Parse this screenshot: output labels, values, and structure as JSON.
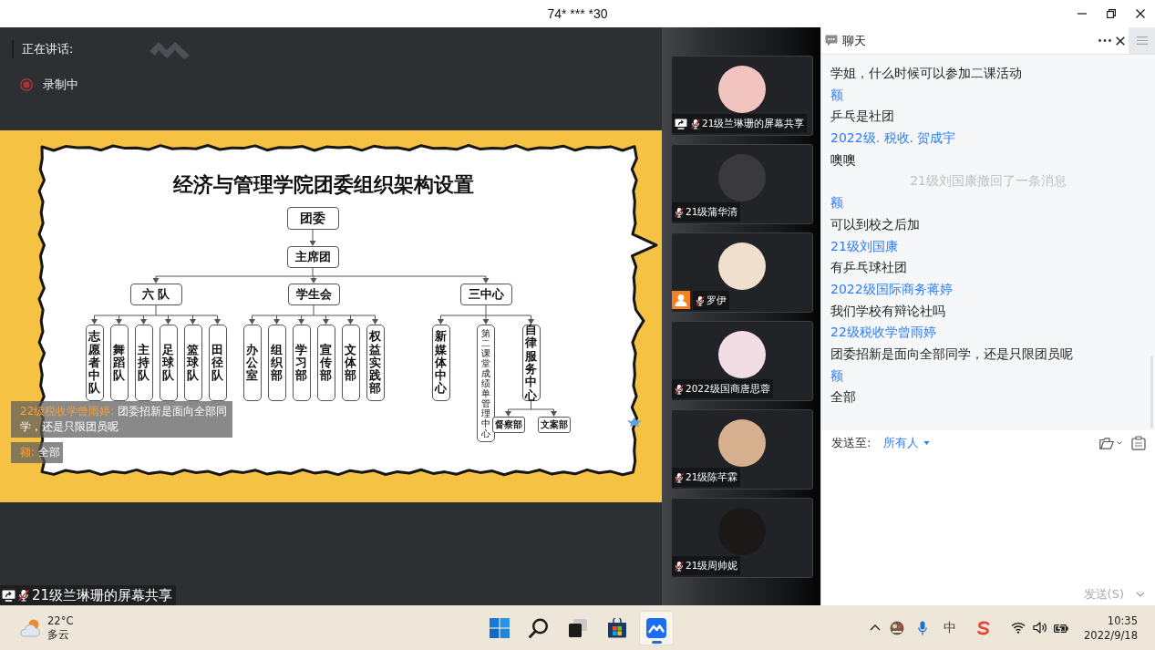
{
  "window": {
    "title": "74* *** *30"
  },
  "stage": {
    "speaking_label": "正在讲话:",
    "recording_label": "录制中"
  },
  "slide": {
    "title": "经济与管理学院团委组织架构设置",
    "org_chart": [
      {
        "label": "团委",
        "children": [
          {
            "label": "主席团",
            "children": [
              {
                "label": "六 队",
                "children": [
                  {
                    "label": "志愿者中队"
                  },
                  {
                    "label": "舞蹈队"
                  },
                  {
                    "label": "主持队"
                  },
                  {
                    "label": "足球队"
                  },
                  {
                    "label": "篮球队"
                  },
                  {
                    "label": "田径队"
                  }
                ]
              },
              {
                "label": "学生会",
                "children": [
                  {
                    "label": "办公室"
                  },
                  {
                    "label": "组织部"
                  },
                  {
                    "label": "学习部"
                  },
                  {
                    "label": "宣传部"
                  },
                  {
                    "label": "文体部"
                  },
                  {
                    "label": "权益实践部"
                  }
                ]
              },
              {
                "label": "三中心",
                "children": [
                  {
                    "label": "新媒体中心"
                  },
                  {
                    "label": "第二课堂成绩单管理中心"
                  },
                  {
                    "label": "自律服务中心",
                    "children": [
                      {
                        "label": "督察部"
                      },
                      {
                        "label": "文案部"
                      }
                    ]
                  }
                ]
              }
            ]
          }
        ]
      }
    ]
  },
  "captions": [
    {
      "name": "22级税收学曾雨婷:",
      "text": "团委招新是面向全部同学，还是只限团员呢"
    },
    {
      "name": "额:",
      "text": "全部"
    }
  ],
  "share_label": {
    "label": "21级兰琳珊的屏幕共享",
    "muted": true
  },
  "participants": [
    {
      "name": "21级兰琳珊的屏幕共享",
      "sharing": true,
      "person_badge": false,
      "muted": true
    },
    {
      "name": "21级蒲华清",
      "sharing": false,
      "person_badge": false,
      "muted": true
    },
    {
      "name": "罗伊",
      "sharing": false,
      "person_badge": true,
      "muted": true
    },
    {
      "name": "2022级国商唐思蓉",
      "sharing": false,
      "person_badge": false,
      "muted": true
    },
    {
      "name": "21级陈芊霖",
      "sharing": false,
      "person_badge": false,
      "muted": true
    },
    {
      "name": "21级周帅妮",
      "sharing": false,
      "person_badge": false,
      "muted": true
    }
  ],
  "chat": {
    "title": "聊天",
    "lines": [
      {
        "kind": "text",
        "text": "学姐，什么时候可以参加二课活动"
      },
      {
        "kind": "name",
        "text": "额"
      },
      {
        "kind": "text",
        "text": "乒乓是社团"
      },
      {
        "kind": "name",
        "text": "2022级. 税收. 贺成宇"
      },
      {
        "kind": "text",
        "text": "噢噢"
      },
      {
        "kind": "notice",
        "text": "21级刘国康撤回了一条消息"
      },
      {
        "kind": "name",
        "text": "额"
      },
      {
        "kind": "text",
        "text": "可以到校之后加"
      },
      {
        "kind": "name",
        "text": "21级刘国康"
      },
      {
        "kind": "text",
        "text": "有乒乓球社团"
      },
      {
        "kind": "name",
        "text": "2022级国际商务蒋婷"
      },
      {
        "kind": "text",
        "text": "我们学校有辩论社吗"
      },
      {
        "kind": "name",
        "text": "22级税收学曾雨婷"
      },
      {
        "kind": "text",
        "text": "团委招新是面向全部同学，还是只限团员呢"
      },
      {
        "kind": "name",
        "text": "额"
      },
      {
        "kind": "text",
        "text": "全部"
      }
    ],
    "send_to": {
      "label": "发送至:",
      "value": "所有人"
    },
    "send_button": {
      "label": "发送(S)",
      "disabled": true
    }
  },
  "taskbar": {
    "weather": {
      "temp": "22°C",
      "condition": "多云"
    },
    "apps": [
      {
        "kind": "start",
        "selected": false
      },
      {
        "kind": "search",
        "selected": false
      },
      {
        "kind": "task_view",
        "selected": false
      },
      {
        "kind": "store",
        "selected": false
      },
      {
        "kind": "meeting",
        "selected": true
      }
    ],
    "ime": "中",
    "clock": {
      "time": "10:35",
      "date": "2022/9/18"
    }
  }
}
